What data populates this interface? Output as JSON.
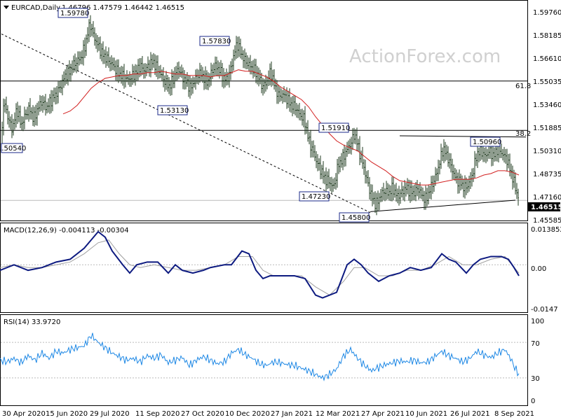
{
  "chart_data": {
    "type": "candlestick",
    "symbol_line": "EURCAD,Daily",
    "ohlc_text": "1.46796 1.47579 1.46442 1.46515",
    "watermark": "ActionForex.com",
    "price_axis": {
      "ticks": [
        "1.59760",
        "1.58185",
        "1.56610",
        "1.55035",
        "1.53460",
        "1.51885",
        "1.50310",
        "1.48735",
        "1.47160",
        "1.45585"
      ],
      "range": [
        1.4515,
        1.6051
      ],
      "current": "1.46515"
    },
    "x_axis": {
      "ticks": [
        "30 Apr 2020",
        "15 Jun 2020",
        "29 Jul 2020",
        "11 Sep 2020",
        "27 Oct 2020",
        "10 Dec 2020",
        "27 Jan 2021",
        "12 Mar 2021",
        "27 Apr 2021",
        "10 Jun 2021",
        "26 Jul 2021",
        "8 Sep 2021"
      ]
    },
    "fib_levels": [
      {
        "label": "61.8",
        "value": 1.5491
      },
      {
        "label": "38.2",
        "value": 1.5144
      }
    ],
    "annotations": [
      "1.59780",
      "1.57830",
      "1.53130",
      "1.51910",
      "1.50960",
      "1.50540",
      "1.47230",
      "1.45800"
    ],
    "close_path": [
      [
        0,
        1.505
      ],
      [
        6,
        1.535
      ],
      [
        12,
        1.522
      ],
      [
        18,
        1.515
      ],
      [
        24,
        1.53
      ],
      [
        30,
        1.518
      ],
      [
        36,
        1.525
      ],
      [
        42,
        1.53
      ],
      [
        48,
        1.522
      ],
      [
        54,
        1.53
      ],
      [
        60,
        1.535
      ],
      [
        66,
        1.53
      ],
      [
        72,
        1.535
      ],
      [
        80,
        1.54
      ],
      [
        86,
        1.545
      ],
      [
        92,
        1.552
      ],
      [
        98,
        1.555
      ],
      [
        104,
        1.56
      ],
      [
        110,
        1.563
      ],
      [
        116,
        1.566
      ],
      [
        122,
        1.575
      ],
      [
        128,
        1.59
      ],
      [
        134,
        1.58
      ],
      [
        140,
        1.574
      ],
      [
        146,
        1.568
      ],
      [
        152,
        1.565
      ],
      [
        158,
        1.562
      ],
      [
        164,
        1.558
      ],
      [
        170,
        1.554
      ],
      [
        176,
        1.552
      ],
      [
        182,
        1.55
      ],
      [
        188,
        1.552
      ],
      [
        194,
        1.555
      ],
      [
        200,
        1.56
      ],
      [
        206,
        1.556
      ],
      [
        212,
        1.56
      ],
      [
        218,
        1.563
      ],
      [
        224,
        1.558
      ],
      [
        230,
        1.553
      ],
      [
        236,
        1.548
      ],
      [
        242,
        1.545
      ],
      [
        248,
        1.552
      ],
      [
        254,
        1.558
      ],
      [
        260,
        1.552
      ],
      [
        266,
        1.548
      ],
      [
        272,
        1.544
      ],
      [
        278,
        1.55
      ],
      [
        284,
        1.555
      ],
      [
        290,
        1.552
      ],
      [
        296,
        1.548
      ],
      [
        302,
        1.556
      ],
      [
        308,
        1.56
      ],
      [
        314,
        1.556
      ],
      [
        320,
        1.55
      ],
      [
        326,
        1.552
      ],
      [
        332,
        1.564
      ],
      [
        338,
        1.576
      ],
      [
        344,
        1.568
      ],
      [
        350,
        1.563
      ],
      [
        356,
        1.56
      ],
      [
        362,
        1.557
      ],
      [
        368,
        1.553
      ],
      [
        374,
        1.545
      ],
      [
        380,
        1.548
      ],
      [
        386,
        1.556
      ],
      [
        392,
        1.545
      ],
      [
        398,
        1.538
      ],
      [
        404,
        1.54
      ],
      [
        410,
        1.536
      ],
      [
        416,
        1.532
      ],
      [
        422,
        1.53
      ],
      [
        428,
        1.525
      ],
      [
        434,
        1.522
      ],
      [
        440,
        1.508
      ],
      [
        446,
        1.5
      ],
      [
        452,
        1.492
      ],
      [
        458,
        1.486
      ],
      [
        464,
        1.48
      ],
      [
        470,
        1.478
      ],
      [
        476,
        1.474
      ],
      [
        482,
        1.49
      ],
      [
        488,
        1.494
      ],
      [
        494,
        1.5
      ],
      [
        500,
        1.505
      ],
      [
        506,
        1.512
      ],
      [
        512,
        1.5
      ],
      [
        518,
        1.49
      ],
      [
        524,
        1.478
      ],
      [
        530,
        1.468
      ],
      [
        536,
        1.462
      ],
      [
        542,
        1.468
      ],
      [
        548,
        1.472
      ],
      [
        554,
        1.47
      ],
      [
        560,
        1.474
      ],
      [
        566,
        1.468
      ],
      [
        572,
        1.47
      ],
      [
        578,
        1.474
      ],
      [
        584,
        1.472
      ],
      [
        590,
        1.47
      ],
      [
        596,
        1.474
      ],
      [
        602,
        1.468
      ],
      [
        608,
        1.466
      ],
      [
        614,
        1.474
      ],
      [
        620,
        1.48
      ],
      [
        626,
        1.49
      ],
      [
        632,
        1.502
      ],
      [
        638,
        1.496
      ],
      [
        644,
        1.488
      ],
      [
        650,
        1.48
      ],
      [
        656,
        1.478
      ],
      [
        662,
        1.474
      ],
      [
        668,
        1.476
      ],
      [
        674,
        1.484
      ],
      [
        680,
        1.498
      ],
      [
        686,
        1.5
      ],
      [
        692,
        1.496
      ],
      [
        698,
        1.5
      ],
      [
        704,
        1.496
      ],
      [
        710,
        1.502
      ],
      [
        716,
        1.498
      ],
      [
        722,
        1.495
      ],
      [
        728,
        1.486
      ],
      [
        734,
        1.476
      ],
      [
        740,
        1.465
      ]
    ],
    "ma_path": [
      [
        90,
        1.526
      ],
      [
        100,
        1.528
      ],
      [
        110,
        1.532
      ],
      [
        120,
        1.538
      ],
      [
        130,
        1.544
      ],
      [
        140,
        1.548
      ],
      [
        150,
        1.551
      ],
      [
        160,
        1.552
      ],
      [
        170,
        1.553
      ],
      [
        180,
        1.553
      ],
      [
        190,
        1.554
      ],
      [
        200,
        1.554
      ],
      [
        210,
        1.555
      ],
      [
        220,
        1.555
      ],
      [
        230,
        1.556
      ],
      [
        240,
        1.555
      ],
      [
        250,
        1.554
      ],
      [
        260,
        1.554
      ],
      [
        270,
        1.553
      ],
      [
        280,
        1.553
      ],
      [
        290,
        1.553
      ],
      [
        300,
        1.552
      ],
      [
        310,
        1.553
      ],
      [
        320,
        1.553
      ],
      [
        330,
        1.555
      ],
      [
        340,
        1.557
      ],
      [
        350,
        1.556
      ],
      [
        360,
        1.556
      ],
      [
        370,
        1.554
      ],
      [
        380,
        1.552
      ],
      [
        390,
        1.549
      ],
      [
        400,
        1.545
      ],
      [
        410,
        1.542
      ],
      [
        420,
        1.539
      ],
      [
        430,
        1.536
      ],
      [
        440,
        1.531
      ],
      [
        450,
        1.524
      ],
      [
        460,
        1.518
      ],
      [
        470,
        1.512
      ],
      [
        480,
        1.507
      ],
      [
        490,
        1.504
      ],
      [
        500,
        1.502
      ],
      [
        510,
        1.5
      ],
      [
        520,
        1.496
      ],
      [
        530,
        1.492
      ],
      [
        540,
        1.489
      ],
      [
        550,
        1.486
      ],
      [
        560,
        1.482
      ],
      [
        570,
        1.479
      ],
      [
        580,
        1.478
      ],
      [
        590,
        1.477
      ],
      [
        600,
        1.476
      ],
      [
        610,
        1.476
      ],
      [
        620,
        1.477
      ],
      [
        630,
        1.478
      ],
      [
        640,
        1.479
      ],
      [
        650,
        1.48
      ],
      [
        660,
        1.48
      ],
      [
        670,
        1.48
      ],
      [
        680,
        1.481
      ],
      [
        690,
        1.483
      ],
      [
        700,
        1.484
      ],
      [
        710,
        1.486
      ],
      [
        720,
        1.486
      ],
      [
        730,
        1.485
      ],
      [
        740,
        1.483
      ]
    ],
    "macd_panel": {
      "title": "MACD(12,26,9) -0.004113 -0.00304",
      "ticks": [
        "0.013852",
        "0.00",
        "-0.0147"
      ],
      "range": [
        -0.0172,
        0.0148
      ],
      "macd_path": [
        [
          0,
          -0.002
        ],
        [
          20,
          0.0
        ],
        [
          40,
          -0.002
        ],
        [
          60,
          -0.001
        ],
        [
          80,
          0.001
        ],
        [
          100,
          0.002
        ],
        [
          120,
          0.006
        ],
        [
          140,
          0.012
        ],
        [
          150,
          0.01
        ],
        [
          160,
          0.005
        ],
        [
          175,
          0.0
        ],
        [
          185,
          -0.003
        ],
        [
          195,
          0.0
        ],
        [
          210,
          0.001
        ],
        [
          225,
          0.001
        ],
        [
          240,
          -0.003
        ],
        [
          250,
          0.0
        ],
        [
          260,
          -0.002
        ],
        [
          275,
          -0.003
        ],
        [
          290,
          -0.002
        ],
        [
          300,
          -0.001
        ],
        [
          320,
          0.0
        ],
        [
          330,
          0.0
        ],
        [
          345,
          0.005
        ],
        [
          355,
          0.004
        ],
        [
          365,
          -0.002
        ],
        [
          375,
          -0.005
        ],
        [
          385,
          -0.004
        ],
        [
          400,
          -0.004
        ],
        [
          420,
          -0.004
        ],
        [
          435,
          -0.005
        ],
        [
          450,
          -0.011
        ],
        [
          460,
          -0.012
        ],
        [
          470,
          -0.011
        ],
        [
          480,
          -0.01
        ],
        [
          495,
          0.0
        ],
        [
          505,
          0.002
        ],
        [
          515,
          0.0
        ],
        [
          525,
          -0.003
        ],
        [
          540,
          -0.006
        ],
        [
          555,
          -0.004
        ],
        [
          570,
          -0.003
        ],
        [
          585,
          -0.001
        ],
        [
          600,
          -0.002
        ],
        [
          615,
          -0.001
        ],
        [
          630,
          0.004
        ],
        [
          640,
          0.002
        ],
        [
          650,
          0.001
        ],
        [
          665,
          -0.003
        ],
        [
          675,
          0.0
        ],
        [
          685,
          0.002
        ],
        [
          700,
          0.003
        ],
        [
          715,
          0.003
        ],
        [
          725,
          0.002
        ],
        [
          733,
          -0.001
        ],
        [
          740,
          -0.004
        ]
      ],
      "signal_path": [
        [
          0,
          -0.001
        ],
        [
          20,
          0.0
        ],
        [
          40,
          -0.001
        ],
        [
          60,
          -0.001
        ],
        [
          80,
          0.0
        ],
        [
          100,
          0.001
        ],
        [
          120,
          0.004
        ],
        [
          140,
          0.008
        ],
        [
          155,
          0.009
        ],
        [
          170,
          0.004
        ],
        [
          185,
          0.0
        ],
        [
          200,
          -0.001
        ],
        [
          220,
          0.0
        ],
        [
          240,
          -0.001
        ],
        [
          260,
          -0.002
        ],
        [
          280,
          -0.002
        ],
        [
          300,
          -0.001
        ],
        [
          320,
          0.0
        ],
        [
          340,
          0.003
        ],
        [
          360,
          0.003
        ],
        [
          375,
          -0.002
        ],
        [
          390,
          -0.004
        ],
        [
          410,
          -0.004
        ],
        [
          430,
          -0.004
        ],
        [
          450,
          -0.008
        ],
        [
          470,
          -0.011
        ],
        [
          490,
          -0.006
        ],
        [
          505,
          -0.001
        ],
        [
          520,
          -0.001
        ],
        [
          540,
          -0.004
        ],
        [
          560,
          -0.004
        ],
        [
          580,
          -0.002
        ],
        [
          600,
          -0.002
        ],
        [
          620,
          0.0
        ],
        [
          640,
          0.003
        ],
        [
          660,
          0.0
        ],
        [
          680,
          0.0
        ],
        [
          700,
          0.002
        ],
        [
          720,
          0.003
        ],
        [
          740,
          -0.003
        ]
      ]
    },
    "rsi_panel": {
      "title": "RSI(14) 33.9720",
      "ticks": [
        "100",
        "70",
        "30",
        "0"
      ],
      "range": [
        0,
        100
      ],
      "rsi_path": [
        [
          0,
          50
        ],
        [
          10,
          48
        ],
        [
          20,
          52
        ],
        [
          30,
          47
        ],
        [
          40,
          55
        ],
        [
          50,
          50
        ],
        [
          60,
          58
        ],
        [
          70,
          52
        ],
        [
          80,
          60
        ],
        [
          90,
          58
        ],
        [
          100,
          62
        ],
        [
          110,
          64
        ],
        [
          120,
          66
        ],
        [
          130,
          78
        ],
        [
          140,
          70
        ],
        [
          150,
          64
        ],
        [
          160,
          58
        ],
        [
          170,
          54
        ],
        [
          180,
          50
        ],
        [
          190,
          52
        ],
        [
          200,
          48
        ],
        [
          210,
          55
        ],
        [
          220,
          52
        ],
        [
          230,
          56
        ],
        [
          240,
          47
        ],
        [
          250,
          50
        ],
        [
          260,
          53
        ],
        [
          270,
          44
        ],
        [
          280,
          50
        ],
        [
          290,
          54
        ],
        [
          300,
          50
        ],
        [
          310,
          46
        ],
        [
          320,
          48
        ],
        [
          330,
          58
        ],
        [
          340,
          62
        ],
        [
          350,
          56
        ],
        [
          360,
          52
        ],
        [
          370,
          46
        ],
        [
          380,
          44
        ],
        [
          390,
          48
        ],
        [
          400,
          47
        ],
        [
          410,
          45
        ],
        [
          420,
          44
        ],
        [
          430,
          41
        ],
        [
          440,
          38
        ],
        [
          450,
          34
        ],
        [
          460,
          30
        ],
        [
          470,
          34
        ],
        [
          480,
          40
        ],
        [
          490,
          55
        ],
        [
          500,
          62
        ],
        [
          510,
          52
        ],
        [
          520,
          44
        ],
        [
          530,
          38
        ],
        [
          540,
          42
        ],
        [
          550,
          45
        ],
        [
          560,
          47
        ],
        [
          570,
          49
        ],
        [
          580,
          48
        ],
        [
          590,
          50
        ],
        [
          600,
          47
        ],
        [
          610,
          48
        ],
        [
          620,
          54
        ],
        [
          630,
          60
        ],
        [
          640,
          55
        ],
        [
          650,
          52
        ],
        [
          660,
          48
        ],
        [
          670,
          52
        ],
        [
          680,
          60
        ],
        [
          690,
          56
        ],
        [
          700,
          53
        ],
        [
          710,
          58
        ],
        [
          720,
          62
        ],
        [
          728,
          52
        ],
        [
          735,
          40
        ],
        [
          740,
          34
        ]
      ]
    }
  }
}
